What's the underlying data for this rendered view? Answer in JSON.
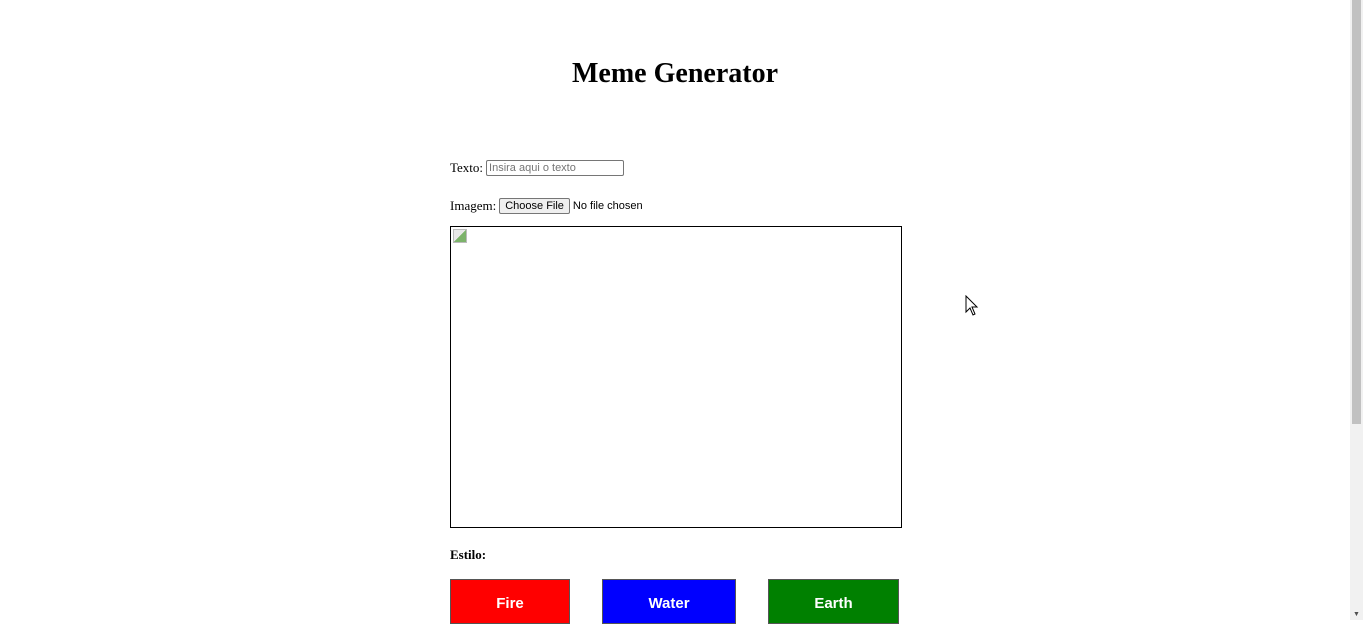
{
  "title": "Meme Generator",
  "form": {
    "text_label": "Texto:",
    "text_placeholder": "Insira aqui o texto",
    "text_value": "",
    "image_label": "Imagem:",
    "file_button": "Choose File",
    "file_status": "No file chosen"
  },
  "style": {
    "label": "Estilo:",
    "buttons": [
      {
        "label": "Fire",
        "color": "#ff0000"
      },
      {
        "label": "Water",
        "color": "#0000ff"
      },
      {
        "label": "Earth",
        "color": "#008000"
      }
    ]
  }
}
